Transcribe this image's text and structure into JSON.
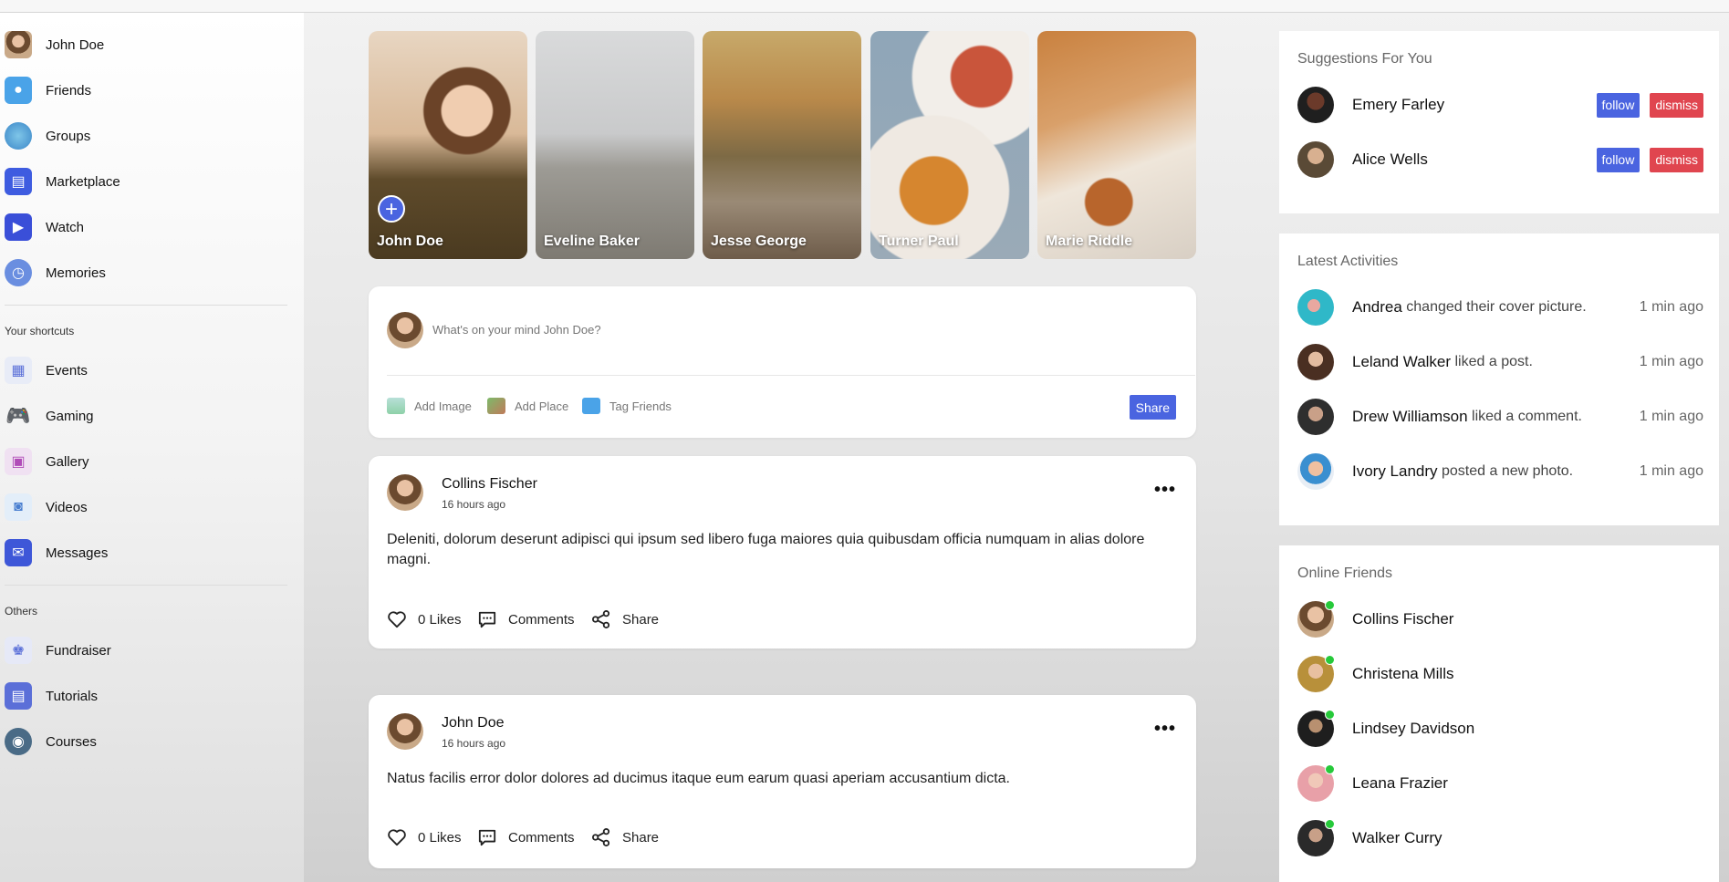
{
  "sidebar": {
    "main_items": [
      {
        "label": "John Doe",
        "icon": "user-avatar-icon"
      },
      {
        "label": "Friends",
        "icon": "friends-icon"
      },
      {
        "label": "Groups",
        "icon": "groups-icon"
      },
      {
        "label": "Marketplace",
        "icon": "marketplace-icon"
      },
      {
        "label": "Watch",
        "icon": "watch-icon"
      },
      {
        "label": "Memories",
        "icon": "memories-icon"
      }
    ],
    "shortcuts_heading": "Your shortcuts",
    "shortcuts": [
      {
        "label": "Events",
        "icon": "events-icon"
      },
      {
        "label": "Gaming",
        "icon": "gaming-icon"
      },
      {
        "label": "Gallery",
        "icon": "gallery-icon"
      },
      {
        "label": "Videos",
        "icon": "videos-icon"
      },
      {
        "label": "Messages",
        "icon": "messages-icon"
      }
    ],
    "others_heading": "Others",
    "others": [
      {
        "label": "Fundraiser",
        "icon": "fundraiser-icon"
      },
      {
        "label": "Tutorials",
        "icon": "tutorials-icon"
      },
      {
        "label": "Courses",
        "icon": "courses-icon"
      }
    ]
  },
  "stories": [
    {
      "name": "John Doe",
      "is_own": true
    },
    {
      "name": "Eveline Baker"
    },
    {
      "name": "Jesse George"
    },
    {
      "name": "Turner Paul"
    },
    {
      "name": "Marie Riddle"
    }
  ],
  "composer": {
    "placeholder": "What's on your mind John Doe?",
    "add_image": "Add Image",
    "add_place": "Add Place",
    "tag_friends": "Tag Friends",
    "share": "Share"
  },
  "posts": [
    {
      "author": "Collins Fischer",
      "time": "16 hours ago",
      "body": "Deleniti, dolorum deserunt adipisci qui ipsum sed libero fuga maiores quia quibusdam officia numquam in alias dolore magni.",
      "likes": "0 Likes",
      "comments": "Comments",
      "share": "Share"
    },
    {
      "author": "John Doe",
      "time": "16 hours ago",
      "body": "Natus facilis error dolor dolores ad ducimus itaque eum earum quasi aperiam accusantium dicta.",
      "likes": "0 Likes",
      "comments": "Comments",
      "share": "Share"
    }
  ],
  "suggestions": {
    "title": "Suggestions For You",
    "people": [
      {
        "name": "Emery Farley",
        "follow": "follow",
        "dismiss": "dismiss"
      },
      {
        "name": "Alice Wells",
        "follow": "follow",
        "dismiss": "dismiss"
      }
    ]
  },
  "activities": {
    "title": "Latest Activities",
    "items": [
      {
        "name": "Andrea",
        "action": "changed their cover picture.",
        "time": "1 min ago"
      },
      {
        "name": "Leland Walker",
        "action": "liked a post.",
        "time": "1 min ago"
      },
      {
        "name": "Drew Williamson",
        "action": "liked a comment.",
        "time": "1 min ago"
      },
      {
        "name": "Ivory Landry",
        "action": "posted a new photo.",
        "time": "1 min ago"
      }
    ]
  },
  "online": {
    "title": "Online Friends",
    "friends": [
      {
        "name": "Collins Fischer"
      },
      {
        "name": "Christena Mills"
      },
      {
        "name": "Lindsey Davidson"
      },
      {
        "name": "Leana Frazier"
      },
      {
        "name": "Walker Curry"
      }
    ]
  },
  "colors": {
    "accent": "#4a64e0",
    "danger": "#e0454f",
    "online": "#26c93a"
  }
}
